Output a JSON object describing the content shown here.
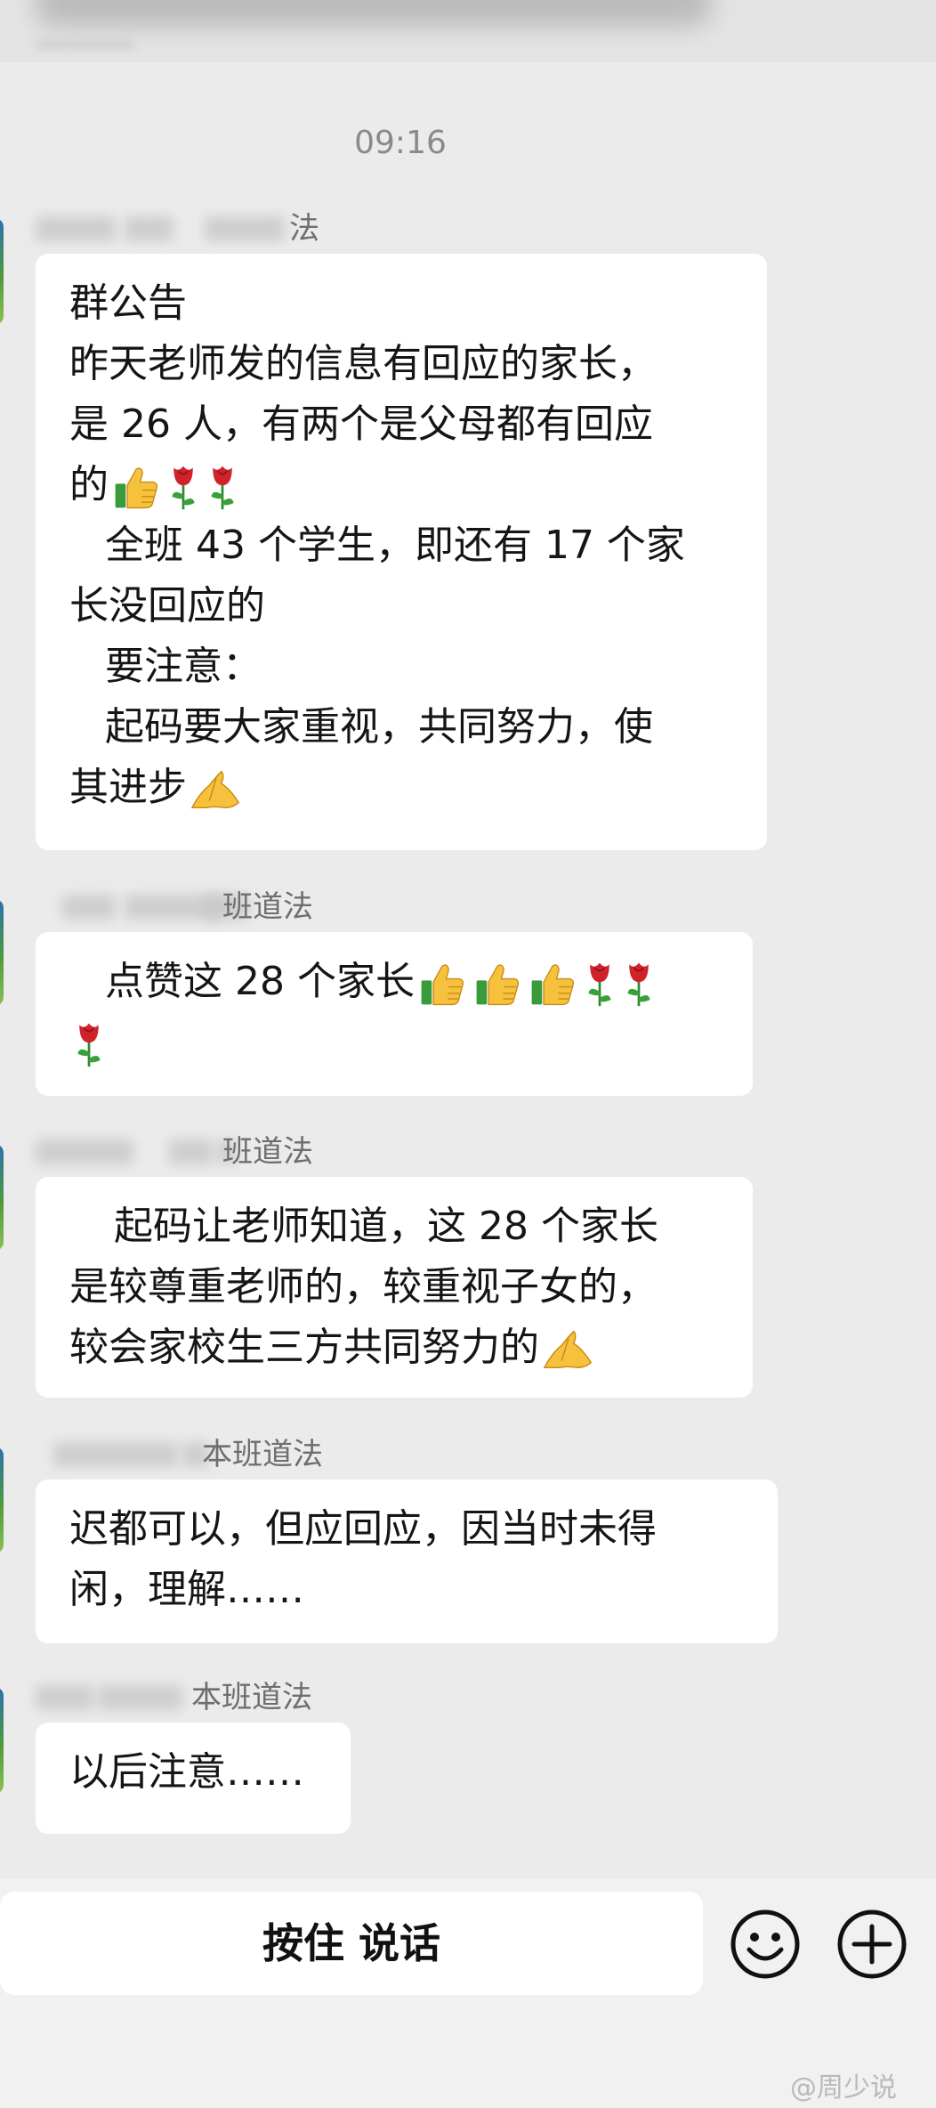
{
  "chat": {
    "timestamp": "09:16",
    "messages": [
      {
        "sender_suffix": "法",
        "lines": [
          "群公告",
          "昨天老师发的信息有回应的家长，",
          "是 26 人，有两个是父母都有回应",
          "的",
          "全班 43 个学生，即还有 17 个家",
          "长没回应的",
          "要注意：",
          "起码要大家重视，共同努力，使",
          "其进步"
        ]
      },
      {
        "sender_suffix": "班道法",
        "lines": [
          "点赞这 28 个家长"
        ]
      },
      {
        "sender_suffix": "班道法",
        "lines": [
          "起码让老师知道，这 28 个家长",
          "是较尊重老师的，较重视子女的，",
          "较会家校生三方共同努力的"
        ]
      },
      {
        "sender_suffix": "本班道法",
        "lines": [
          "迟都可以，但应回应，因当时未得",
          "闲，理解……"
        ]
      },
      {
        "sender_suffix": "本班道法",
        "lines": [
          "以后注意……"
        ]
      }
    ]
  },
  "input_bar": {
    "hold_to_talk_label": "按住 说话"
  },
  "icons": {
    "emoji": "smiley-face-icon",
    "plus": "plus-circle-icon",
    "thumbs_up": "thumbs-up-icon",
    "rose": "rose-icon",
    "pray": "folded-hands-icon"
  },
  "watermark": {
    "text": "@周少说"
  },
  "colors": {
    "chat_background": "#ebebeb",
    "bubble": "#ffffff",
    "timestamp": "#8a8a8a",
    "sender_name": "#6e6e6e"
  }
}
